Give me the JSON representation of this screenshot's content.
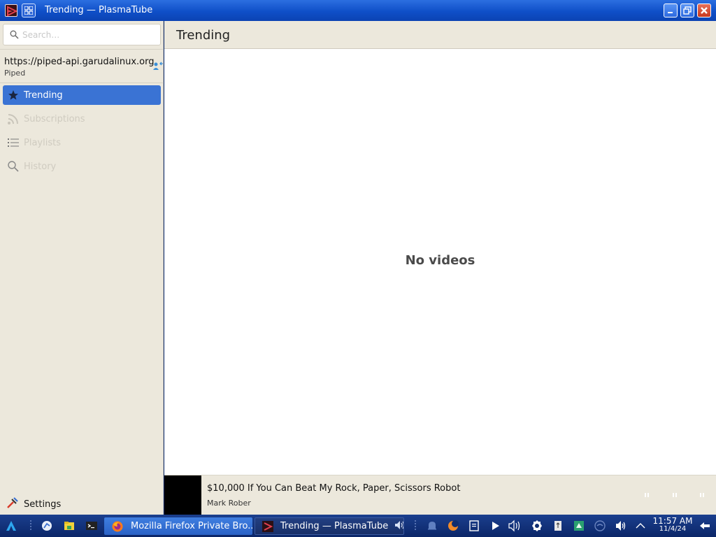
{
  "window": {
    "title": "Trending — PlasmaTube"
  },
  "sidebar": {
    "search_placeholder": "Search…",
    "account": {
      "url": "https://piped-api.garudalinux.org",
      "type": "Piped"
    },
    "items": [
      {
        "label": "Trending",
        "icon": "star-icon",
        "active": true
      },
      {
        "label": "Subscriptions",
        "icon": "rss-icon",
        "active": false
      },
      {
        "label": "Playlists",
        "icon": "list-icon",
        "active": false
      },
      {
        "label": "History",
        "icon": "search-icon",
        "active": false
      }
    ],
    "settings_label": "Settings"
  },
  "main": {
    "heading": "Trending",
    "empty_text": "No videos"
  },
  "player": {
    "title": "$10,000 If You Can Beat My Rock, Paper, Scissors Robot",
    "author": "Mark Rober"
  },
  "taskbar": {
    "tasks": [
      {
        "label": "Mozilla Firefox Private Bro...",
        "icon": "firefox-icon",
        "active": true
      },
      {
        "label": "Trending — PlasmaTube",
        "icon": "plasmatube-icon",
        "active": false
      }
    ],
    "clock": {
      "time": "11:57 AM",
      "date": "11/4/24"
    }
  },
  "colors": {
    "accent": "#3a73d4",
    "titlebar": "#1553cc",
    "sidebar_bg": "#ece8dc",
    "taskbar": "#0b2668"
  }
}
